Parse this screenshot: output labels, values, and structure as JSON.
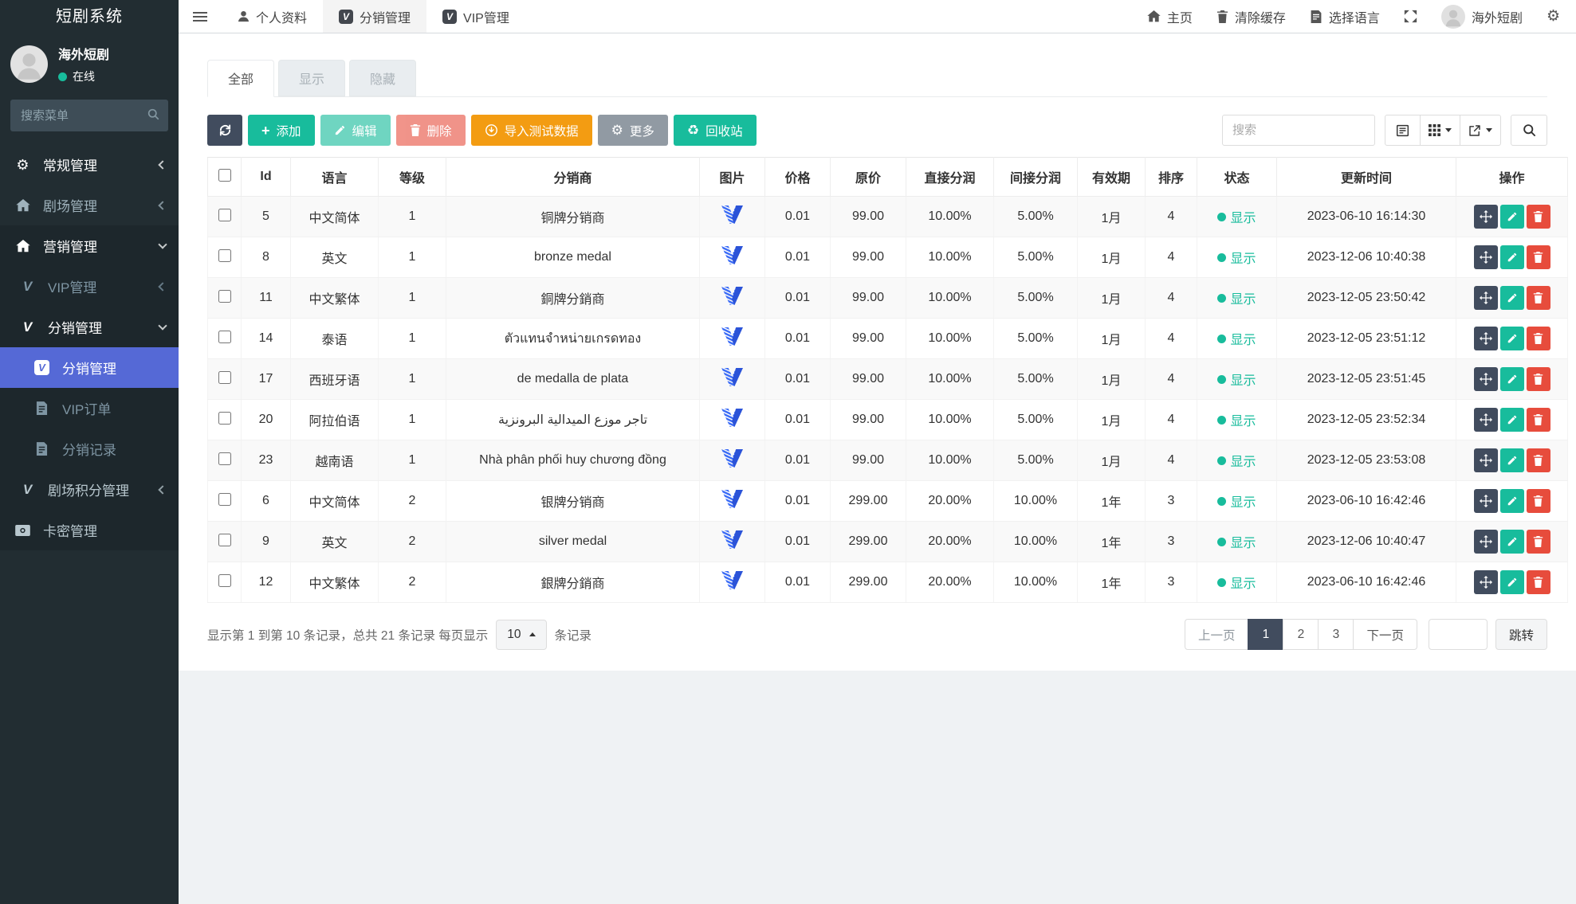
{
  "app": {
    "brand": "短剧系统"
  },
  "sidebar": {
    "user": {
      "name": "海外短剧",
      "status": "在线"
    },
    "search_placeholder": "搜索菜单",
    "menu": {
      "general": "常规管理",
      "theater": "剧场管理",
      "marketing": "营销管理",
      "vip": "VIP管理",
      "distribution": "分销管理",
      "distribution_child": "分销管理",
      "vip_order": "VIP订单",
      "distribution_record": "分销记录",
      "theater_points": "剧场积分管理",
      "card_key": "卡密管理"
    }
  },
  "navbar": {
    "tabs": [
      {
        "label": "个人资料"
      },
      {
        "label": "分销管理"
      },
      {
        "label": "VIP管理"
      }
    ],
    "home": "主页",
    "clear_cache": "清除缓存",
    "language": "选择语言",
    "username": "海外短剧"
  },
  "filter_tabs": {
    "all": "全部",
    "show": "显示",
    "hide": "隐藏"
  },
  "toolbar": {
    "add": "添加",
    "edit": "编辑",
    "delete": "删除",
    "import": "导入测试数据",
    "more": "更多",
    "recycle": "回收站",
    "search_placeholder": "搜索"
  },
  "table": {
    "headers": [
      "Id",
      "语言",
      "等级",
      "分销商",
      "图片",
      "价格",
      "原价",
      "直接分润",
      "间接分润",
      "有效期",
      "排序",
      "状态",
      "更新时间",
      "操作"
    ],
    "rows": [
      {
        "id": "5",
        "language": "中文简体",
        "level": "1",
        "name": "铜牌分销商",
        "price": "0.01",
        "original": "99.00",
        "direct": "10.00%",
        "indirect": "5.00%",
        "validity": "1月",
        "sort": "4",
        "status": "显示",
        "updated": "2023-06-10 16:14:30"
      },
      {
        "id": "8",
        "language": "英文",
        "level": "1",
        "name": "bronze medal",
        "price": "0.01",
        "original": "99.00",
        "direct": "10.00%",
        "indirect": "5.00%",
        "validity": "1月",
        "sort": "4",
        "status": "显示",
        "updated": "2023-12-06 10:40:38"
      },
      {
        "id": "11",
        "language": "中文繁体",
        "level": "1",
        "name": "銅牌分銷商",
        "price": "0.01",
        "original": "99.00",
        "direct": "10.00%",
        "indirect": "5.00%",
        "validity": "1月",
        "sort": "4",
        "status": "显示",
        "updated": "2023-12-05 23:50:42"
      },
      {
        "id": "14",
        "language": "泰语",
        "level": "1",
        "name": "ตัวแทนจำหน่ายเกรดทอง",
        "price": "0.01",
        "original": "99.00",
        "direct": "10.00%",
        "indirect": "5.00%",
        "validity": "1月",
        "sort": "4",
        "status": "显示",
        "updated": "2023-12-05 23:51:12"
      },
      {
        "id": "17",
        "language": "西班牙语",
        "level": "1",
        "name": "de medalla de plata",
        "price": "0.01",
        "original": "99.00",
        "direct": "10.00%",
        "indirect": "5.00%",
        "validity": "1月",
        "sort": "4",
        "status": "显示",
        "updated": "2023-12-05 23:51:45"
      },
      {
        "id": "20",
        "language": "阿拉伯语",
        "level": "1",
        "name": "تاجر موزع الميدالية البرونزية",
        "price": "0.01",
        "original": "99.00",
        "direct": "10.00%",
        "indirect": "5.00%",
        "validity": "1月",
        "sort": "4",
        "status": "显示",
        "updated": "2023-12-05 23:52:34"
      },
      {
        "id": "23",
        "language": "越南语",
        "level": "1",
        "name": "Nhà phân phối huy chương đồng",
        "price": "0.01",
        "original": "99.00",
        "direct": "10.00%",
        "indirect": "5.00%",
        "validity": "1月",
        "sort": "4",
        "status": "显示",
        "updated": "2023-12-05 23:53:08"
      },
      {
        "id": "6",
        "language": "中文简体",
        "level": "2",
        "name": "银牌分销商",
        "price": "0.01",
        "original": "299.00",
        "direct": "20.00%",
        "indirect": "10.00%",
        "validity": "1年",
        "sort": "3",
        "status": "显示",
        "updated": "2023-06-10 16:42:46"
      },
      {
        "id": "9",
        "language": "英文",
        "level": "2",
        "name": "silver medal",
        "price": "0.01",
        "original": "299.00",
        "direct": "20.00%",
        "indirect": "10.00%",
        "validity": "1年",
        "sort": "3",
        "status": "显示",
        "updated": "2023-12-06 10:40:47"
      },
      {
        "id": "12",
        "language": "中文繁体",
        "level": "2",
        "name": "銀牌分銷商",
        "price": "0.01",
        "original": "299.00",
        "direct": "20.00%",
        "indirect": "10.00%",
        "validity": "1年",
        "sort": "3",
        "status": "显示",
        "updated": "2023-06-10 16:42:46"
      }
    ]
  },
  "footer": {
    "summary_prefix": "显示第 1 到第 10 条记录，总共 21 条记录 每页显示",
    "per_page": "10",
    "summary_suffix": "条记录",
    "pagination": {
      "prev": "上一页",
      "pages": [
        "1",
        "2",
        "3"
      ],
      "next": "下一页",
      "jump": "跳转"
    }
  },
  "colors": {
    "sidebar_bg": "#222d32",
    "active_menu_blue": "#5569d6",
    "accent_green": "#18bc9c",
    "accent_orange": "#f39c12",
    "danger_red": "#e74c3c",
    "dark_navy": "#414c5e",
    "logo_blue": "#3b6cf6"
  }
}
